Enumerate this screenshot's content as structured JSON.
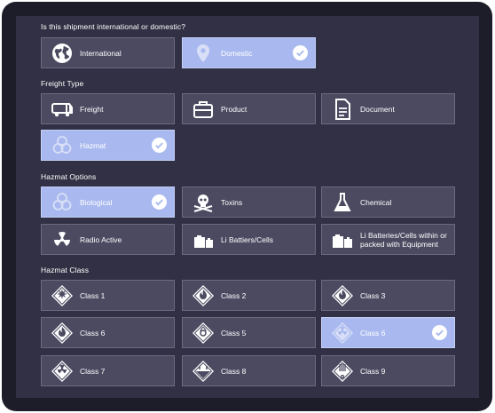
{
  "questions": {
    "shipment": "Is this shipment international or domestic?",
    "freight": "Freight Type",
    "hazmat_options": "Hazmat Options",
    "hazmat_class": "Hazmat Class"
  },
  "shipment_options": [
    {
      "label": "International",
      "icon": "globe-icon",
      "selected": false
    },
    {
      "label": "Domestic",
      "icon": "location-pin-icon",
      "selected": true
    }
  ],
  "freight_types": [
    {
      "label": "Freight",
      "icon": "truck-icon",
      "selected": false
    },
    {
      "label": "Product",
      "icon": "briefcase-icon",
      "selected": false
    },
    {
      "label": "Document",
      "icon": "document-icon",
      "selected": false
    },
    {
      "label": "Hazmat",
      "icon": "biohazard-icon",
      "selected": true
    }
  ],
  "hazmat_options": [
    {
      "label": "Biological",
      "icon": "biohazard-icon",
      "selected": true
    },
    {
      "label": "Toxins",
      "icon": "skull-crossbones-icon",
      "selected": false
    },
    {
      "label": "Chemical",
      "icon": "flask-icon",
      "selected": false
    },
    {
      "label": "Radio Active",
      "icon": "radiation-icon",
      "selected": false
    },
    {
      "label": "Li Battiers/Cells",
      "icon": "battery-icon",
      "selected": false
    },
    {
      "label": "Li Batteries/Cells within or packed with Equipment",
      "icon": "battery-equipment-icon",
      "selected": false
    }
  ],
  "hazmat_classes": [
    {
      "label": "Class 1",
      "icon": "class-1-diamond-icon",
      "selected": false
    },
    {
      "label": "Class 2",
      "icon": "class-2-diamond-icon",
      "selected": false
    },
    {
      "label": "Class 3",
      "icon": "class-3-diamond-icon",
      "selected": false
    },
    {
      "label": "Class 6",
      "icon": "class-6-diamond-icon",
      "selected": false
    },
    {
      "label": "Class 5",
      "icon": "class-5-diamond-icon",
      "selected": false
    },
    {
      "label": "Class  6",
      "icon": "class-6-radioactive-diamond-icon",
      "selected": true
    },
    {
      "label": "Class 7",
      "icon": "class-7-diamond-icon",
      "selected": false
    },
    {
      "label": "Class 8",
      "icon": "class-8-diamond-icon",
      "selected": false
    },
    {
      "label": "Class 9",
      "icon": "class-9-diamond-icon",
      "selected": false
    }
  ],
  "colors": {
    "background": "#1c1d29",
    "panel": "#313044",
    "option": "#4b4a61",
    "option_selected": "#a9b9ef"
  }
}
